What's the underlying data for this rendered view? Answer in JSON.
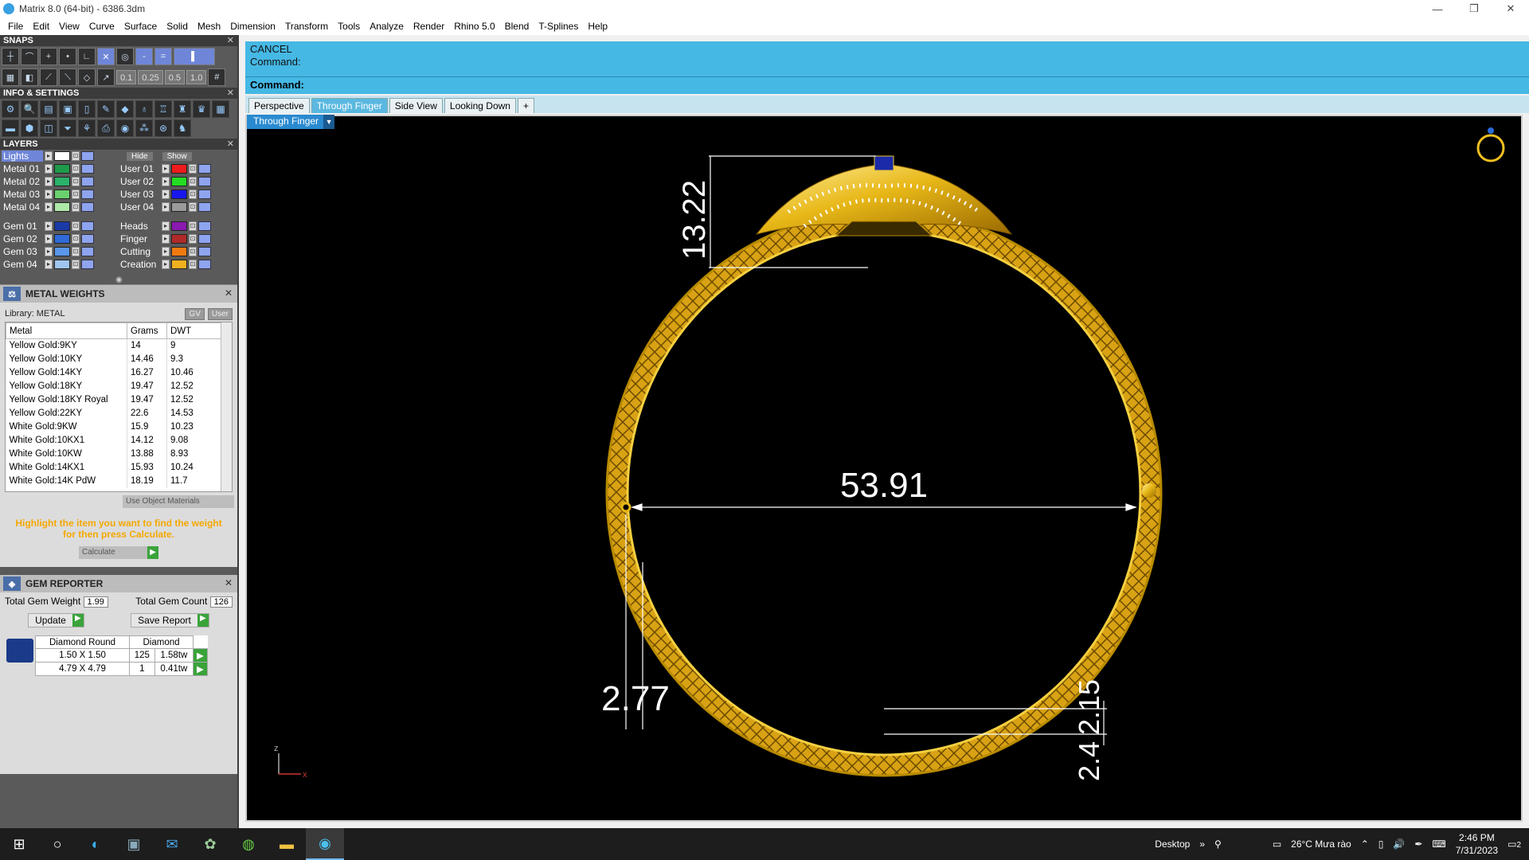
{
  "window": {
    "title": "Matrix 8.0 (64-bit) - 6386.3dm",
    "minimize": "—",
    "restore": "❐",
    "close": "✕"
  },
  "menu": [
    "File",
    "Edit",
    "View",
    "Curve",
    "Surface",
    "Solid",
    "Mesh",
    "Dimension",
    "Transform",
    "Tools",
    "Analyze",
    "Render",
    "Rhino 5.0",
    "Blend",
    "T-Splines",
    "Help"
  ],
  "snaps": {
    "title": "SNAPS",
    "tolerances": [
      "0.1",
      "0.25",
      "0.5",
      "1.0"
    ]
  },
  "info": {
    "title": "INFO & SETTINGS"
  },
  "layers": {
    "title": "LAYERS",
    "hide_label": "Hide",
    "show_label": "Show",
    "left": [
      {
        "name": "Lights",
        "color": "#ffffff"
      },
      {
        "name": "Metal 01",
        "color": "#1f9a4a"
      },
      {
        "name": "Metal 02",
        "color": "#2bb36a"
      },
      {
        "name": "Metal 03",
        "color": "#6ad16e"
      },
      {
        "name": "Metal 04",
        "color": "#aee8a8"
      },
      {
        "name": "Gem 01",
        "color": "#1a3aa8"
      },
      {
        "name": "Gem 02",
        "color": "#2f6ad8"
      },
      {
        "name": "Gem 03",
        "color": "#5a96ea"
      },
      {
        "name": "Gem 04",
        "color": "#9fc6f0"
      }
    ],
    "right": [
      {
        "name": "User 01",
        "color": "#ee1c1c"
      },
      {
        "name": "User 02",
        "color": "#22dd22"
      },
      {
        "name": "User 03",
        "color": "#1818ee"
      },
      {
        "name": "User 04",
        "color": "#9a9a9a"
      },
      {
        "name": "Heads",
        "color": "#8a1ab0"
      },
      {
        "name": "Finger",
        "color": "#b02a2a"
      },
      {
        "name": "Cutting",
        "color": "#f07a10"
      },
      {
        "name": "Creation",
        "color": "#f0b020"
      }
    ]
  },
  "metal_weights": {
    "title": "METAL WEIGHTS",
    "library": "Library: METAL",
    "toggle_gv": "GV",
    "toggle_user": "User",
    "headers": [
      "Metal",
      "Grams",
      "DWT"
    ],
    "rows": [
      [
        "Yellow Gold:9KY",
        "14",
        "9"
      ],
      [
        "Yellow Gold:10KY",
        "14.46",
        "9.3"
      ],
      [
        "Yellow Gold:14KY",
        "16.27",
        "10.46"
      ],
      [
        "Yellow Gold:18KY",
        "19.47",
        "12.52"
      ],
      [
        "Yellow Gold:18KY Royal",
        "19.47",
        "12.52"
      ],
      [
        "Yellow Gold:22KY",
        "22.6",
        "14.53"
      ],
      [
        "White Gold:9KW",
        "15.9",
        "10.23"
      ],
      [
        "White Gold:10KX1",
        "14.12",
        "9.08"
      ],
      [
        "White Gold:10KW",
        "13.88",
        "8.93"
      ],
      [
        "White Gold:14KX1",
        "15.93",
        "10.24"
      ],
      [
        "White Gold:14K PdW",
        "18.19",
        "11.7"
      ]
    ],
    "use_object_materials": "Use Object Materials",
    "hint": "Highlight the item you want to find the weight for then press Calculate.",
    "calculate": "Calculate"
  },
  "gem_reporter": {
    "title": "GEM REPORTER",
    "total_weight_label": "Total Gem Weight",
    "total_weight": "1.99",
    "total_count_label": "Total Gem Count",
    "total_count": "126",
    "update": "Update",
    "save_report": "Save Report",
    "headers": [
      "Diamond Round",
      "Diamond"
    ],
    "rows": [
      [
        "1.50 X 1.50",
        "125",
        "1.58tw"
      ],
      [
        "4.79 X 4.79",
        "1",
        "0.41tw"
      ]
    ]
  },
  "command": {
    "history1": "CANCEL",
    "history2": "Command:",
    "prompt": "Command:",
    "value": ""
  },
  "view_tabs": [
    "Perspective",
    "Through Finger",
    "Side View",
    "Looking Down",
    "+"
  ],
  "active_tab": "Through Finger",
  "view_dropdown": "Through Finger",
  "dimensions": {
    "height": "13.22",
    "diameter": "53.91",
    "thickness": "2.77",
    "bottom1": "2.15",
    "bottom2": "2.4"
  },
  "axis": {
    "z": "z",
    "x": "x"
  },
  "taskbar": {
    "desktop": "Desktop",
    "weather": "26°C  Mưa rào",
    "time": "2:46 PM",
    "date": "7/31/2023",
    "notifications": "2"
  },
  "colors": {
    "cmd_blue": "#45b8e4",
    "gold": "#e8b818",
    "sapphire": "#1a2aa8",
    "hint_orange": "#f5a800"
  }
}
